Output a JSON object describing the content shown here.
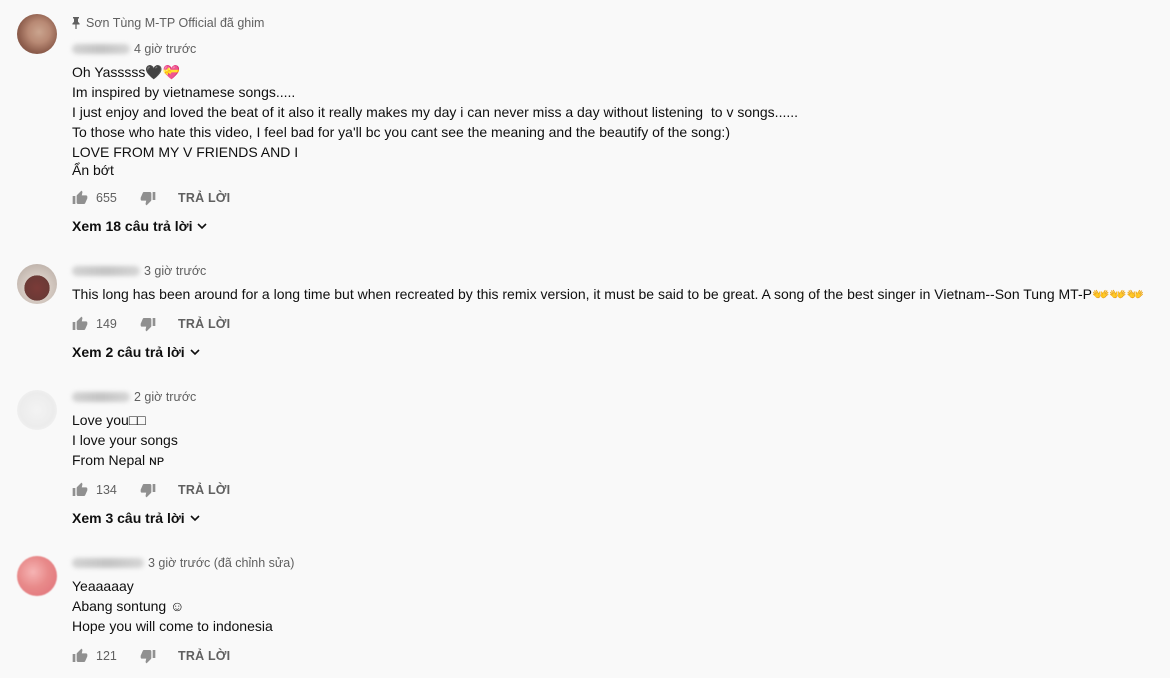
{
  "comments": [
    {
      "pinned_label": "Sơn Tùng M-TP Official đã ghim",
      "author": "Nhoan Lee",
      "time": "4 giờ trước",
      "lines": [
        "Oh Yasssss🖤💝",
        "Im inspired by vietnamese songs.....",
        "I just enjoy and loved the beat of it also it really makes my day i can never miss a day without listening  to v songs......",
        "To those who hate this video, I feel bad for ya'll bc you cant see the meaning and the beautify of the song:)",
        "LOVE FROM MY V FRIENDS AND I"
      ],
      "show_less": "Ẩn bớt",
      "likes": "655",
      "reply_label": "TRẢ LỜI",
      "view_replies": "Xem 18 câu trả lời"
    },
    {
      "author": "Lolly Freedom",
      "time": "3 giờ trước",
      "lines": [
        "This long has been around for a long time but when recreated by this remix version, it must be said to be great. A song of the best singer in Vietnam--Son Tung MT-P👐👐👐"
      ],
      "likes": "149",
      "reply_label": "TRẢ LỜI",
      "view_replies": "Xem 2 câu trả lời"
    },
    {
      "author": "Sky Nepali",
      "time": "2 giờ trước",
      "lines": [
        "Love you□□",
        "I love your songs",
        "From Nepal ɴᴘ"
      ],
      "likes": "134",
      "reply_label": "TRẢ LỜI",
      "view_replies": "Xem 3 câu trả lời"
    },
    {
      "author": "Nouah Rebel",
      "time": "3 giờ trước (đã chỉnh sửa)",
      "lines": [
        "Yeaaaaay",
        "Abang sontung ☺",
        "Hope you will come to indonesia"
      ],
      "likes": "121",
      "reply_label": "TRẢ LỜI"
    }
  ],
  "colors": {
    "background": "#f9f9f9",
    "text_primary": "#0f0f0f",
    "text_secondary": "#606060"
  },
  "icons": [
    "pin-icon",
    "thumbs-up-icon",
    "thumbs-down-icon",
    "chevron-down-icon"
  ]
}
